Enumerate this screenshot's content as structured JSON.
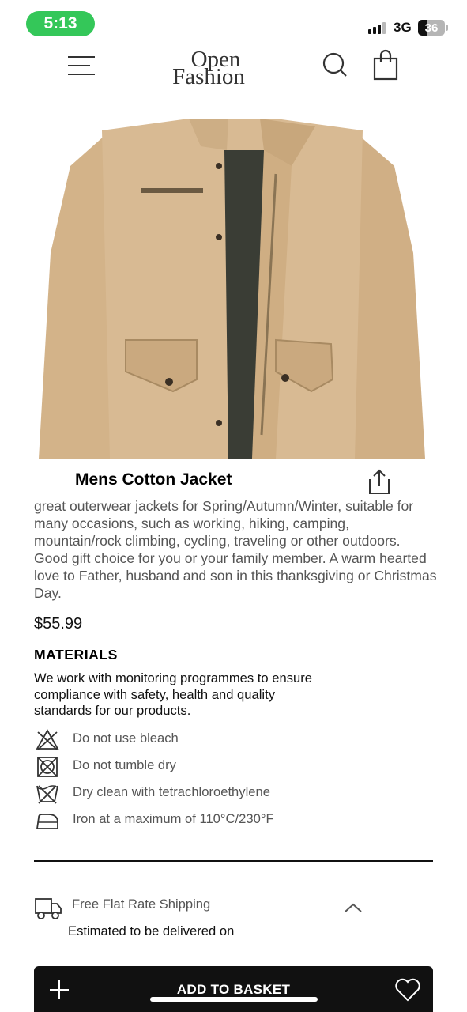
{
  "status_bar": {
    "time": "5:13",
    "network": "3G",
    "battery": "36",
    "time_pill_color": "#34c759"
  },
  "header": {
    "logo_line1": "Open",
    "logo_line2": "Fashion",
    "icons": [
      "menu-icon",
      "search-icon",
      "shopping-bag-icon"
    ]
  },
  "product": {
    "image_description_icon": "jacket-image",
    "title": "Mens Cotton Jacket",
    "description": "great outerwear jackets for Spring/Autumn/Winter, suitable for many occasions, such as working, hiking, camping, mountain/rock climbing, cycling, traveling or other outdoors. Good gift choice for you or your family member. A warm hearted love to Father, husband and son in this thanksgiving or Christmas Day.",
    "price": "$55.99"
  },
  "materials": {
    "heading": "MATERIALS",
    "text": "We work with monitoring programmes to ensure compliance with safety, health and quality standards for our products.",
    "care": [
      {
        "icon": "no-bleach-icon",
        "label": "Do not use bleach"
      },
      {
        "icon": "no-tumble-dry-icon",
        "label": "Do not tumble dry"
      },
      {
        "icon": "dry-clean-icon",
        "label": "Dry clean with tetrachloroethylene"
      },
      {
        "icon": "iron-icon",
        "label": "Iron at a maximum of 110°C/230°F"
      }
    ]
  },
  "shipping": {
    "label": "Free Flat Rate Shipping",
    "delivery": "Estimated to be delivered on"
  },
  "bottom_bar": {
    "add_to_basket": "ADD TO BASKET"
  }
}
